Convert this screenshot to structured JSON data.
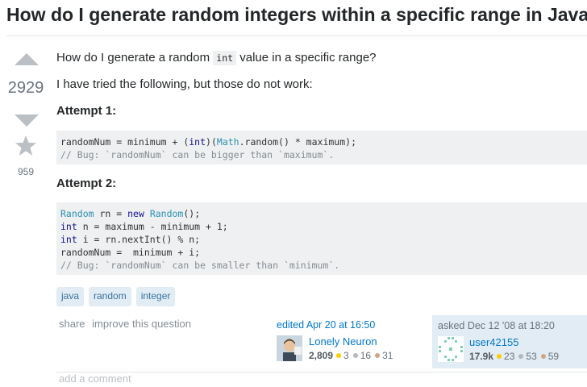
{
  "question": {
    "title": "How do I generate random integers within a specific range in Java?",
    "vote_count": "2929",
    "favorite_count": "959"
  },
  "body": {
    "intro_before": "How do I generate a random ",
    "intro_code": "int",
    "intro_after": " value in a specific range?",
    "tried": "I have tried the following, but those do not work:",
    "attempt1_heading": "Attempt 1:",
    "attempt2_heading": "Attempt 2:"
  },
  "code1": {
    "l1a": "randomNum = minimum + (",
    "l1b": "int",
    "l1c": ")(",
    "l1d": "Math",
    "l1e": ".random() * maximum);",
    "l2": "// Bug: `randomNum` can be bigger than `maximum`."
  },
  "code2": {
    "l1a": "Random",
    "l1b": " rn = ",
    "l1c": "new",
    "l1d": " ",
    "l1e": "Random",
    "l1f": "();",
    "l2a": "int",
    "l2b": " n = maximum - minimum + 1;",
    "l3a": "int",
    "l3b": " i = rn.nextInt() % n;",
    "l4": "randomNum =  minimum + i;",
    "l5": "// Bug: `randomNum` can be smaller than `minimum`."
  },
  "tags": [
    "java",
    "random",
    "integer"
  ],
  "post_menu": {
    "share": "share",
    "improve": "improve this question"
  },
  "editor": {
    "action": "edited Apr 20 at 16:50",
    "name": "Lonely Neuron",
    "rep": "2,809",
    "gold": "3",
    "silver": "16",
    "bronze": "31"
  },
  "asker": {
    "action": "asked Dec 12 '08 at 18:20",
    "name": "user42155",
    "rep": "17.9k",
    "gold": "23",
    "silver": "53",
    "bronze": "59"
  },
  "add_comment": "add a comment",
  "colors": {
    "link": "#0077cc",
    "tag_bg": "#e1ecf4",
    "tag_text": "#39739d",
    "code_bg": "#eff0f1",
    "vote_arrow": "#bbc0c4"
  }
}
